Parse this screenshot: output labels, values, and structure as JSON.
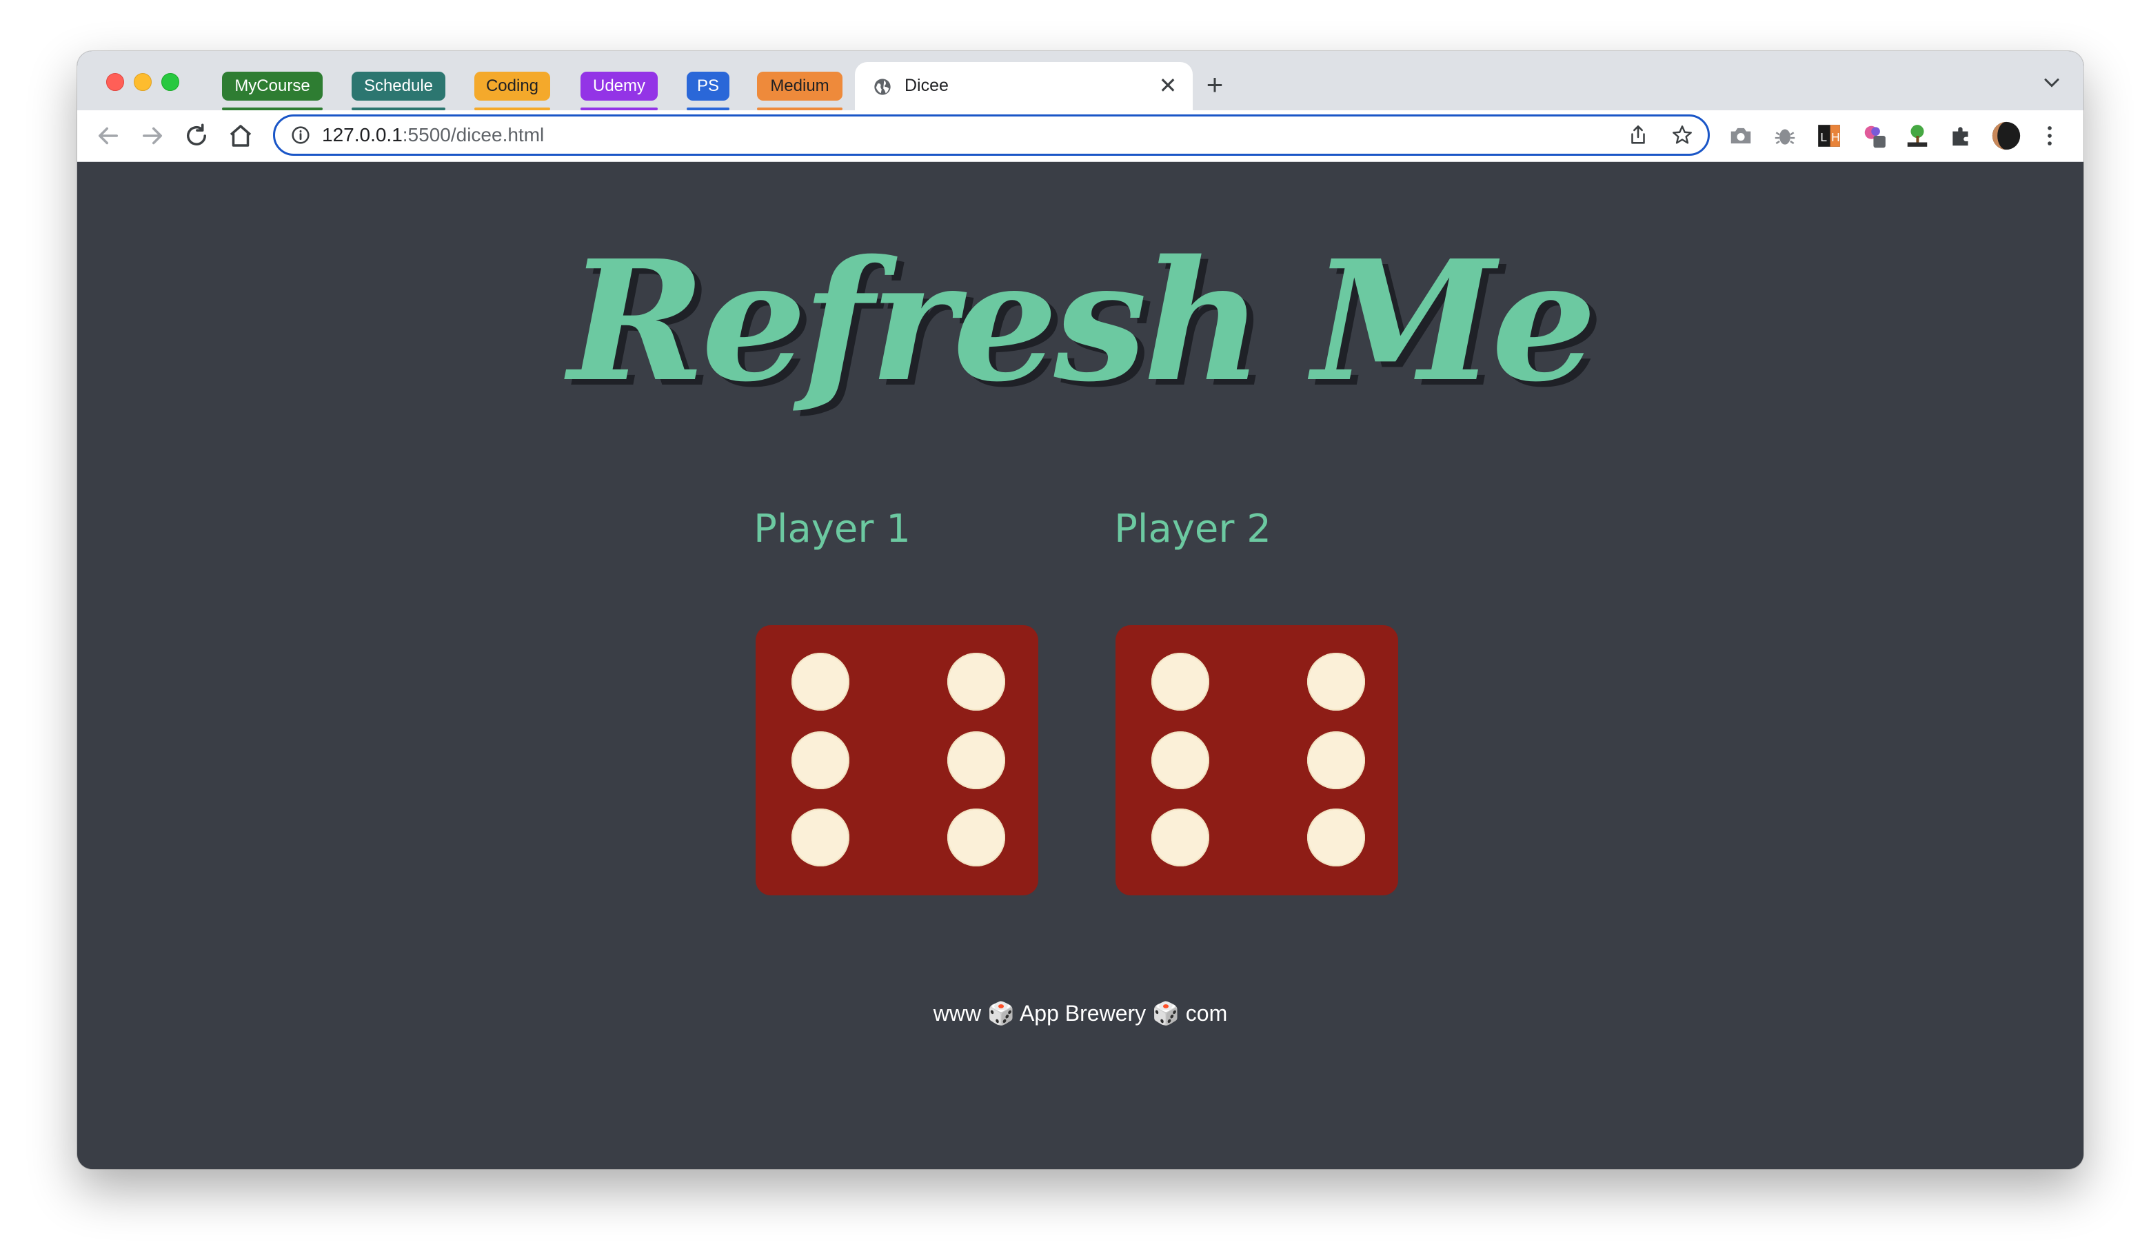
{
  "browser": {
    "tab_groups": [
      {
        "label": "MyCourse",
        "color": "#2e7d32"
      },
      {
        "label": "Schedule",
        "color": "#2c7670"
      },
      {
        "label": "Coding",
        "color": "#f4a92b"
      },
      {
        "label": "Udemy",
        "color": "#9334e6"
      },
      {
        "label": "PS",
        "color": "#2a67d8"
      },
      {
        "label": "Medium",
        "color": "#ee8a3b"
      }
    ],
    "active_tab": {
      "title": "Dicee",
      "close_glyph": "✕"
    },
    "new_tab_glyph": "+",
    "url_host": "127.0.0.1",
    "url_path": ":5500/dicee.html"
  },
  "page": {
    "title": "Refresh Me",
    "players": [
      {
        "label": "Player 1",
        "die_value": 6
      },
      {
        "label": "Player 2",
        "die_value": 6
      }
    ],
    "footer": {
      "prefix": "www",
      "middle": "App Brewery",
      "suffix": "com",
      "icon": "dice-icon"
    }
  },
  "colors": {
    "background": "#3a3e46",
    "accent_green": "#6cc9a1",
    "die_red": "#8e1d16",
    "pip": "#fbf0d8"
  }
}
